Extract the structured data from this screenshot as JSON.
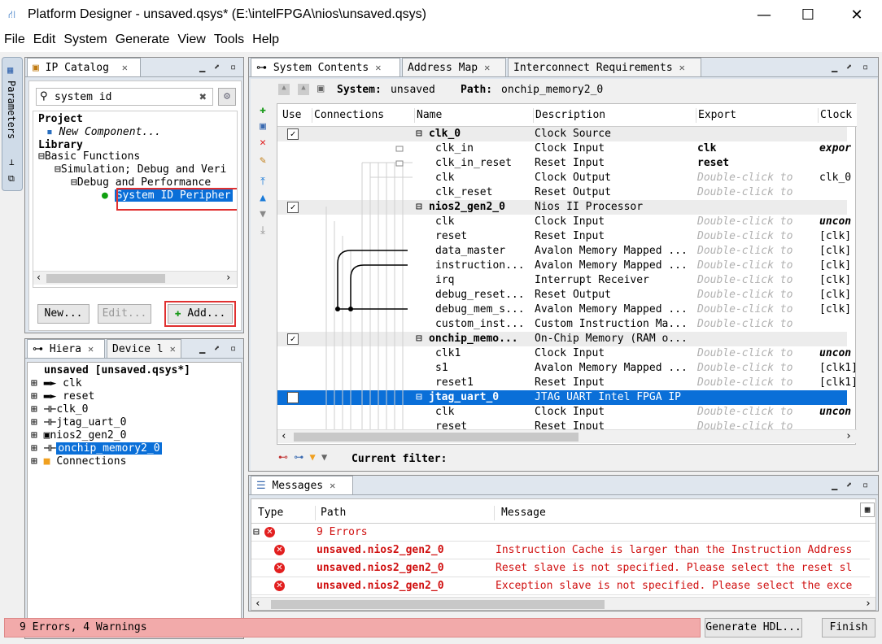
{
  "window": {
    "title": "Platform Designer - unsaved.qsys* (E:\\intelFPGA\\nios\\unsaved.qsys)",
    "min": "—",
    "max": "☐",
    "close": "✕"
  },
  "menu": [
    "File",
    "Edit",
    "System",
    "Generate",
    "View",
    "Tools",
    "Help"
  ],
  "side_tab": {
    "label": "Parameters"
  },
  "ip_catalog": {
    "tab": "IP Catalog",
    "search_value": "system id",
    "tree": {
      "project": "Project",
      "new_component": "New Component...",
      "library": "Library",
      "basic": "Basic Functions",
      "simdebug": "Simulation; Debug and Veri",
      "debugperf": "Debug and Performance",
      "sysid": "System ID Peripher"
    },
    "buttons": {
      "new": "New...",
      "edit": "Edit...",
      "add": "Add..."
    }
  },
  "hierarchy": {
    "tabs": [
      "Hiera",
      "Device l"
    ],
    "root": "unsaved [unsaved.qsys*]",
    "items": [
      "clk",
      "reset",
      "clk_0",
      "jtag_uart_0",
      "nios2_gen2_0",
      "onchip_memory2_0",
      "Connections"
    ]
  },
  "system_contents": {
    "tabs": [
      "System Contents",
      "Address Map",
      "Interconnect Requirements"
    ],
    "system_label": "System:",
    "system_value": "unsaved",
    "path_label": "Path:",
    "path_value": "onchip_memory2_0",
    "columns": [
      "Use",
      "Connections",
      "Name",
      "Description",
      "Export",
      "Clock"
    ],
    "rows": [
      {
        "use": true,
        "name": "clk_0",
        "desc": "Clock Source",
        "export": "",
        "clock": "",
        "kind": "comp"
      },
      {
        "name": "clk_in",
        "desc": "Clock Input",
        "export": "clk",
        "clock": "expor",
        "kind": "port",
        "exp_style": "bold",
        "clk_style": "italicb"
      },
      {
        "name": "clk_in_reset",
        "desc": "Reset Input",
        "export": "reset",
        "clock": "",
        "kind": "port",
        "exp_style": "bold"
      },
      {
        "name": "clk",
        "desc": "Clock Output",
        "export": "Double-click to",
        "clock": "clk_0",
        "kind": "port",
        "exp_style": "gray"
      },
      {
        "name": "clk_reset",
        "desc": "Reset Output",
        "export": "Double-click to",
        "clock": "",
        "kind": "port",
        "exp_style": "gray"
      },
      {
        "use": true,
        "name": "nios2_gen2_0",
        "desc": "Nios II Processor",
        "export": "",
        "clock": "",
        "kind": "comp"
      },
      {
        "name": "clk",
        "desc": "Clock Input",
        "export": "Double-click to",
        "clock": "uncon",
        "kind": "port",
        "exp_style": "gray",
        "clk_style": "italicb"
      },
      {
        "name": "reset",
        "desc": "Reset Input",
        "export": "Double-click to",
        "clock": "[clk]",
        "kind": "port",
        "exp_style": "gray"
      },
      {
        "name": "data_master",
        "desc": "Avalon Memory Mapped ...",
        "export": "Double-click to",
        "clock": "[clk]",
        "kind": "port",
        "exp_style": "gray"
      },
      {
        "name": "instruction...",
        "desc": "Avalon Memory Mapped ...",
        "export": "Double-click to",
        "clock": "[clk]",
        "kind": "port",
        "exp_style": "gray"
      },
      {
        "name": "irq",
        "desc": "Interrupt Receiver",
        "export": "Double-click to",
        "clock": "[clk]",
        "kind": "port",
        "exp_style": "gray"
      },
      {
        "name": "debug_reset...",
        "desc": "Reset Output",
        "export": "Double-click to",
        "clock": "[clk]",
        "kind": "port",
        "exp_style": "gray"
      },
      {
        "name": "debug_mem_s...",
        "desc": "Avalon Memory Mapped ...",
        "export": "Double-click to",
        "clock": "[clk]",
        "kind": "port",
        "exp_style": "gray"
      },
      {
        "name": "custom_inst...",
        "desc": "Custom Instruction Ma...",
        "export": "Double-click to",
        "clock": "",
        "kind": "port",
        "exp_style": "gray"
      },
      {
        "use": true,
        "name": "onchip_memo...",
        "desc": "On-Chip Memory (RAM o...",
        "export": "",
        "clock": "",
        "kind": "comp"
      },
      {
        "name": "clk1",
        "desc": "Clock Input",
        "export": "Double-click to",
        "clock": "uncon",
        "kind": "port",
        "exp_style": "gray",
        "clk_style": "italicb"
      },
      {
        "name": "s1",
        "desc": "Avalon Memory Mapped ...",
        "export": "Double-click to",
        "clock": "[clk1]",
        "kind": "port",
        "exp_style": "gray"
      },
      {
        "name": "reset1",
        "desc": "Reset Input",
        "export": "Double-click to",
        "clock": "[clk1]",
        "kind": "port",
        "exp_style": "gray"
      },
      {
        "use": true,
        "name": "jtag_uart_0",
        "desc": "JTAG UART Intel FPGA IP",
        "export": "",
        "clock": "",
        "kind": "comp",
        "selected": true
      },
      {
        "name": "clk",
        "desc": "Clock Input",
        "export": "Double-click to",
        "clock": "uncon",
        "kind": "port",
        "exp_style": "gray",
        "clk_style": "italicb"
      },
      {
        "name": "reset",
        "desc": "Reset Input",
        "export": "Double-click to",
        "clock": "",
        "kind": "port",
        "exp_style": "gray"
      }
    ],
    "filter_label": "Current filter:"
  },
  "messages": {
    "tab": "Messages",
    "columns": [
      "Type",
      "Path",
      "Message"
    ],
    "summary": "9 Errors",
    "rows": [
      {
        "path": "unsaved.nios2_gen2_0",
        "message": "Instruction Cache is larger than the Instruction Address"
      },
      {
        "path": "unsaved.nios2_gen2_0",
        "message": "Reset slave is not specified. Please select the reset sl"
      },
      {
        "path": "unsaved.nios2_gen2_0",
        "message": "Exception slave is not specified. Please select the exce"
      }
    ]
  },
  "status": {
    "text": "9 Errors, 4 Warnings",
    "generate": "Generate HDL...",
    "finish": "Finish"
  },
  "colors": {
    "selection": "#0a6fd8",
    "error": "#e21f1f",
    "status_bg": "#f2aaaa",
    "highlight_box": "#e03030"
  }
}
